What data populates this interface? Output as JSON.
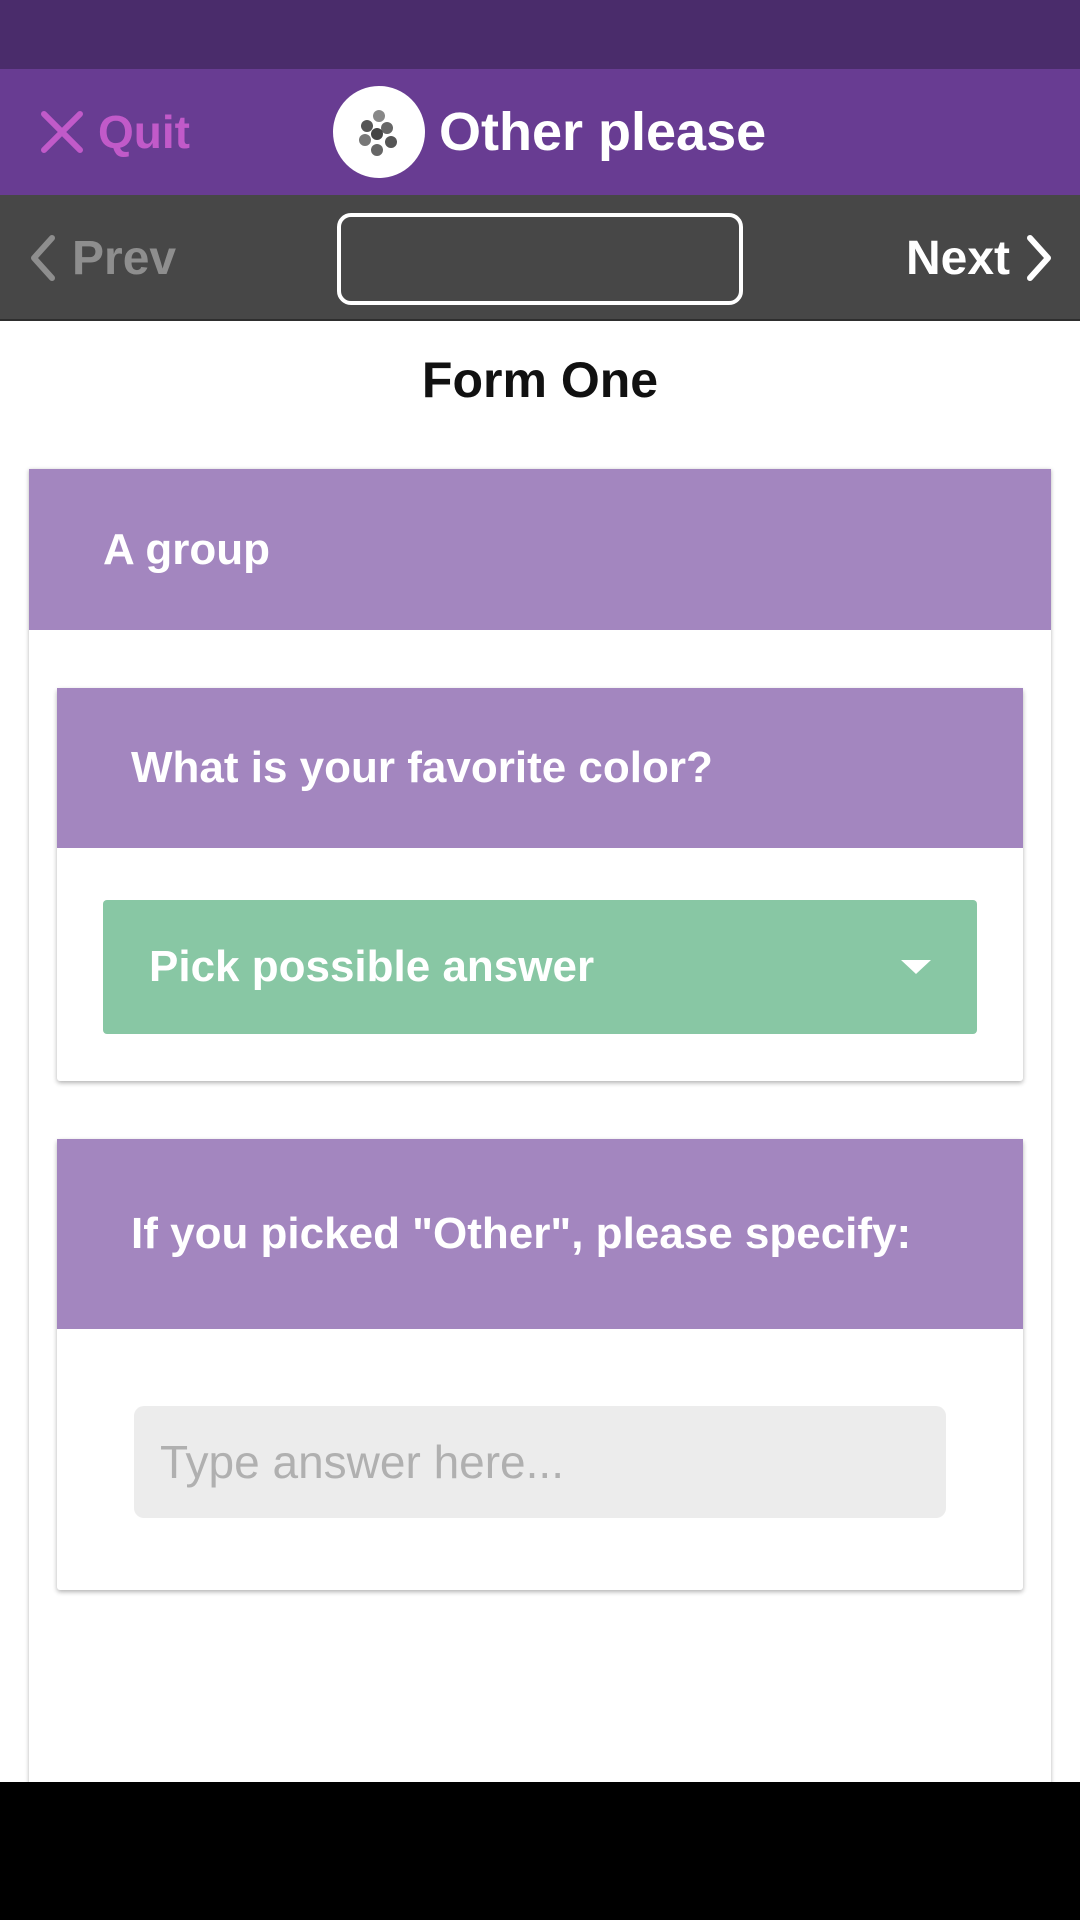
{
  "header": {
    "quit_label": "Quit",
    "title": "Other please",
    "colors": {
      "status_bar": "#4a2c6b",
      "header": "#683c92",
      "quit": "#c15ac9"
    }
  },
  "nav": {
    "prev_label": "Prev",
    "next_label": "Next",
    "jump_value": ""
  },
  "form": {
    "title": "Form One",
    "group": {
      "label": "A group",
      "color": "#a386bf"
    },
    "questions": [
      {
        "label": "What is your favorite color?",
        "select_value": "Pick possible answer",
        "select_color": "#88c7a4"
      },
      {
        "label": "If you picked \"Other\", please specify:",
        "input_value": "",
        "input_placeholder": "Type answer here..."
      }
    ]
  }
}
